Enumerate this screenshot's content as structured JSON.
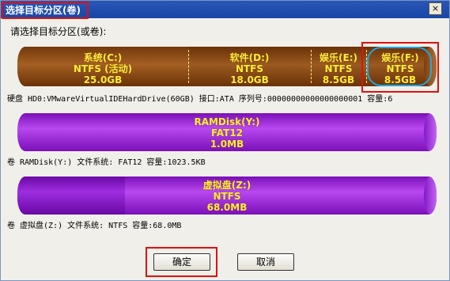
{
  "window": {
    "title": "选择目标分区(卷)",
    "close_label": "×"
  },
  "prompt": "请选择目标分区(或卷):",
  "disks": [
    {
      "partitions": [
        {
          "label": "系统(C:)",
          "fs": "NTFS (活动)",
          "size": "25.0GB"
        },
        {
          "label": "软件(D:)",
          "fs": "NTFS",
          "size": "18.0GB"
        },
        {
          "label": "娱乐(E:)",
          "fs": "NTFS",
          "size": "8.5GB"
        },
        {
          "label": "娱乐(F:)",
          "fs": "NTFS",
          "size": "8.5GB"
        }
      ],
      "info": "硬盘 HD0:VMwareVirtualIDEHardDrive(60GB)    接口:ATA  序列号:00000000000000000001  容量:6"
    },
    {
      "partitions": [
        {
          "label": "RAMDisk(Y:)",
          "fs": "FAT12",
          "size": "1.0MB"
        }
      ],
      "info": "卷 RAMDisk(Y:)   文件系统: FAT12  容量:1023.5KB"
    },
    {
      "partitions": [
        {
          "label": "虚拟盘(Z:)",
          "fs": "NTFS",
          "size": "68.0MB"
        }
      ],
      "info": "卷 虚拟盘(Z:)   文件系统: NTFS  容量:68.0MB"
    }
  ],
  "buttons": {
    "ok": "确定",
    "cancel": "取消"
  },
  "colors": {
    "hd_partition": "#8a4a12",
    "hd_used": "#b5692a",
    "virtual": "#9b24d8",
    "label_text": "#ffef3a",
    "annotation_red": "#e01010",
    "selection_cyan": "#21a7e0"
  }
}
